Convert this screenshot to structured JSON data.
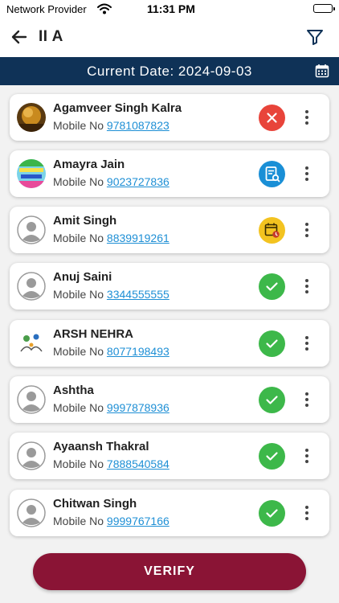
{
  "status_bar": {
    "carrier": "Network Provider",
    "time": "11:31 PM"
  },
  "header": {
    "title": "II A"
  },
  "date_bar": {
    "text": "Current Date: 2024-09-03"
  },
  "students": [
    {
      "name": "Agamveer Singh Kalra",
      "mobile_label": "Mobile No",
      "phone": "9781087823",
      "status": "rejected",
      "avatar": "photo"
    },
    {
      "name": "Amayra Jain",
      "mobile_label": "Mobile No",
      "phone": "9023727836",
      "status": "under-review",
      "avatar": "photo"
    },
    {
      "name": "Amit Singh",
      "mobile_label": "Mobile No",
      "phone": "8839919261",
      "status": "pending",
      "avatar": "placeholder"
    },
    {
      "name": "Anuj Saini",
      "mobile_label": "Mobile No",
      "phone": "3344555555",
      "status": "verified",
      "avatar": "placeholder"
    },
    {
      "name": "ARSH NEHRA",
      "mobile_label": "Mobile No",
      "phone": "8077198493",
      "status": "verified",
      "avatar": "photo"
    },
    {
      "name": "Ashtha",
      "mobile_label": "Mobile No",
      "phone": "9997878936",
      "status": "verified",
      "avatar": "placeholder"
    },
    {
      "name": "Ayaansh Thakral",
      "mobile_label": "Mobile No",
      "phone": "7888540584",
      "status": "verified",
      "avatar": "placeholder"
    },
    {
      "name": "Chitwan Singh",
      "mobile_label": "Mobile No",
      "phone": "9999767166",
      "status": "verified",
      "avatar": "placeholder"
    }
  ],
  "footer": {
    "verify_label": "VERIFY"
  },
  "colors": {
    "header_bg": "#0f3257",
    "verify_button": "#8a1435",
    "rejected": "#e8443a",
    "under_review": "#1a8fd6",
    "pending": "#f3c320",
    "verified": "#3db84a",
    "link": "#1e8fd5"
  }
}
